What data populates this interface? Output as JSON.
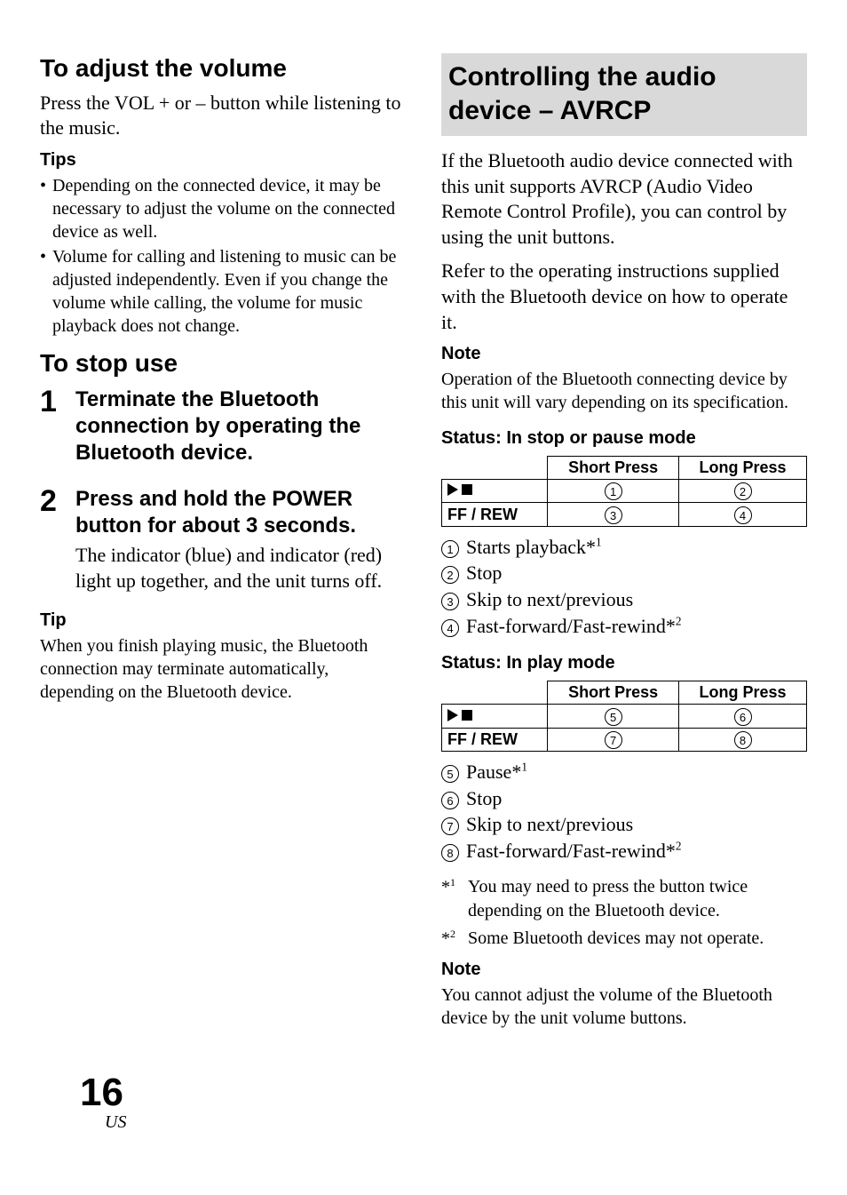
{
  "left": {
    "volume_heading": "To adjust the volume",
    "volume_text": "Press the VOL + or – button while listening to the music.",
    "tips_label": "Tips",
    "tips": [
      "Depending on the connected device, it may be necessary to adjust the volume on the connected device as well.",
      "Volume for calling and listening to music can be adjusted independently. Even if you change the volume while calling, the volume for music playback does not change."
    ],
    "stop_heading": "To stop use",
    "step1_head": "Terminate the Bluetooth connection by operating the Bluetooth device.",
    "step2_head": "Press and hold the POWER button for about 3 seconds.",
    "step2_text": "The indicator (blue) and indicator (red) light up together, and the unit turns off.",
    "tip_label": "Tip",
    "tip_body": "When you finish playing music, the Bluetooth connection may terminate automatically, depending on the Bluetooth device."
  },
  "right": {
    "section_title": "Controlling the audio device – AVRCP",
    "intro1": "If the Bluetooth audio device connected with this unit supports AVRCP (Audio Video Remote Control Profile), you can control by using the unit buttons.",
    "intro2": "Refer to the operating instructions supplied with the Bluetooth device on how to operate it.",
    "note1_label": "Note",
    "note1_body": "Operation of the Bluetooth connecting device by this unit will vary depending on its specification.",
    "status1_title": "Status: In stop or pause mode",
    "status2_title": "Status: In play mode",
    "table_headers": {
      "c1": "Short Press",
      "c2": "Long Press"
    },
    "table1_row2_label": "FF / REW",
    "table2_row2_label": "FF / REW",
    "list1": {
      "i1_a": "Starts playback*",
      "i1_sup": "1",
      "i2": "Stop",
      "i3": "Skip to next/previous",
      "i4_a": "Fast-forward/Fast-rewind*",
      "i4_sup": "2"
    },
    "list2": {
      "i5_a": "Pause*",
      "i5_sup": "1",
      "i6": "Stop",
      "i7": "Skip to next/previous",
      "i8_a": "Fast-forward/Fast-rewind*",
      "i8_sup": "2"
    },
    "fn1_mark_a": "*",
    "fn1_mark_sup": "1",
    "fn1_body": "You may need to press the button twice depending on the Bluetooth device.",
    "fn2_mark_a": "*",
    "fn2_mark_sup": "2",
    "fn2_body": "Some Bluetooth devices may not operate.",
    "note2_label": "Note",
    "note2_body": "You cannot adjust the volume of the Bluetooth device by the unit volume buttons."
  },
  "footer": {
    "page": "16",
    "locale": "US"
  },
  "chart_data": [
    {
      "type": "table",
      "title": "Status: In stop or pause mode",
      "columns": [
        "",
        "Short Press",
        "Long Press"
      ],
      "rows": [
        [
          "▶■ (Play/Stop)",
          "① Starts playback*1",
          "② Stop"
        ],
        [
          "FF / REW",
          "③ Skip to next/previous",
          "④ Fast-forward/Fast-rewind*2"
        ]
      ]
    },
    {
      "type": "table",
      "title": "Status: In play mode",
      "columns": [
        "",
        "Short Press",
        "Long Press"
      ],
      "rows": [
        [
          "▶■ (Play/Stop)",
          "⑤ Pause*1",
          "⑥ Stop"
        ],
        [
          "FF / REW",
          "⑦ Skip to next/previous",
          "⑧ Fast-forward/Fast-rewind*2"
        ]
      ]
    }
  ]
}
